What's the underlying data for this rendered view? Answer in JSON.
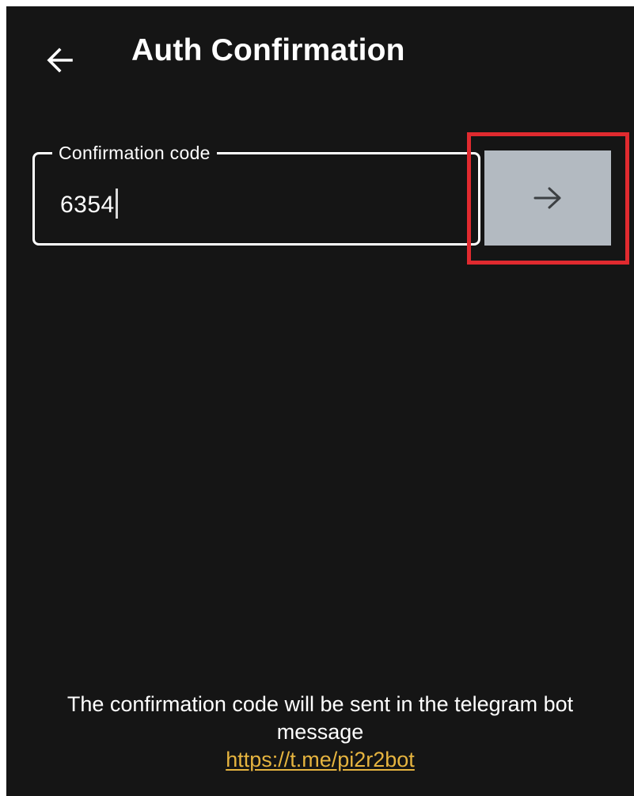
{
  "app_bar": {
    "title": "Auth Confirmation",
    "back_icon": "arrow-left-icon"
  },
  "form": {
    "code_field": {
      "label": "Confirmation code",
      "value": "6354"
    },
    "submit_button": {
      "icon": "arrow-right-icon"
    }
  },
  "highlight": {
    "color": "#e02a2f"
  },
  "footer": {
    "message": "The confirmation code will be sent in the telegram bot message",
    "link": "https://t.me/pi2r2bot"
  },
  "colors": {
    "background": "#151515",
    "button": "#b3bac1",
    "link": "#e6b43f",
    "text": "#ffffff"
  }
}
